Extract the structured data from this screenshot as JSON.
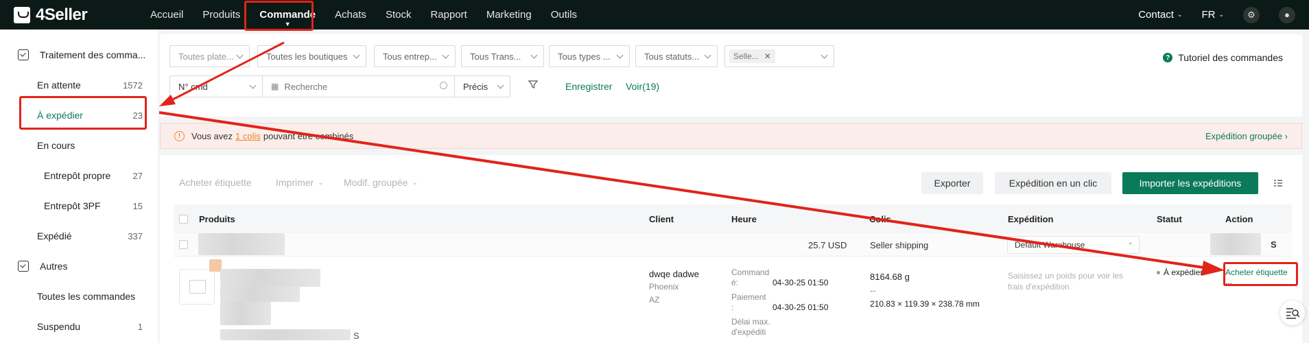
{
  "brand": {
    "name": "4Seller"
  },
  "nav": {
    "items": [
      "Accueil",
      "Produits",
      "Commande",
      "Achats",
      "Stock",
      "Rapport",
      "Marketing",
      "Outils"
    ],
    "contact": "Contact",
    "lang": "FR"
  },
  "sidebar": {
    "group1": "Traitement des comma...",
    "items": [
      {
        "label": "En attente",
        "count": "1572"
      },
      {
        "label": "À expédier",
        "count": "23"
      },
      {
        "label": "En cours",
        "count": ""
      },
      {
        "label": "Entrepôt propre",
        "count": "27"
      },
      {
        "label": "Entrepôt 3PF",
        "count": "15"
      },
      {
        "label": "Expédié",
        "count": "337"
      }
    ],
    "group2": "Autres",
    "items2": [
      {
        "label": "Toutes les commandes",
        "count": ""
      },
      {
        "label": "Suspendu",
        "count": "1"
      }
    ]
  },
  "filters": {
    "platforms": "Toutes plate...",
    "shops": "Toutes les boutiques",
    "warehouses": "Tous entrep...",
    "transport": "Tous Trans...",
    "types": "Tous types ...",
    "statuses": "Tous statuts...",
    "seller_tag": "Selle...",
    "search_type": "N° cmd",
    "search_placeholder": "Recherche",
    "precision": "Précis",
    "save": "Enregistrer",
    "view": "Voir(19)",
    "tutorial": "Tutoriel des commandes"
  },
  "alert": {
    "prefix": "Vous avez",
    "link": "1 colis",
    "suffix": "pouvant être combinés",
    "grouped": "Expédition groupée"
  },
  "toolbar": {
    "buy_label": "Acheter étiquette",
    "print": "Imprimer",
    "bulk_edit": "Modif. groupée",
    "export": "Exporter",
    "one_click": "Expédition en un clic",
    "import": "Importer les expéditions"
  },
  "table": {
    "headers": [
      "Produits",
      "Client",
      "Heure",
      "Colis",
      "Expédition",
      "Statut",
      "Action"
    ],
    "row1": {
      "amount": "25.7 USD",
      "shipping": "Seller shipping",
      "warehouse": "Default Warehouse",
      "suffix": "S"
    },
    "row2": {
      "product_suffix": "S",
      "client_name": "dwqe dadwe",
      "client_city": "Phoenix",
      "client_state": "AZ",
      "time_order_label_1": "Command",
      "time_order_label_2": "é:",
      "time_order": "04-30-25 01:50",
      "time_pay_label_1": "Paiement",
      "time_pay_label_2": ":",
      "time_pay": "04-30-25 01:50",
      "time_max_label_1": "Délai max.",
      "time_max_label_2": "d'expéditi",
      "weight": "8164.68 g",
      "dash": "--",
      "dims": "210.83 × 119.39 × 238.78 mm",
      "shipping_hint_1": "Saisissez un poids pour voir les",
      "shipping_hint_2": "frais d'expédition",
      "status": "À expédier",
      "action": "Acheter étiquette",
      "more": "..."
    }
  },
  "colors": {
    "accent": "#0b7a5a",
    "annotation": "#e0241b",
    "topbar": "#0c1a17"
  }
}
